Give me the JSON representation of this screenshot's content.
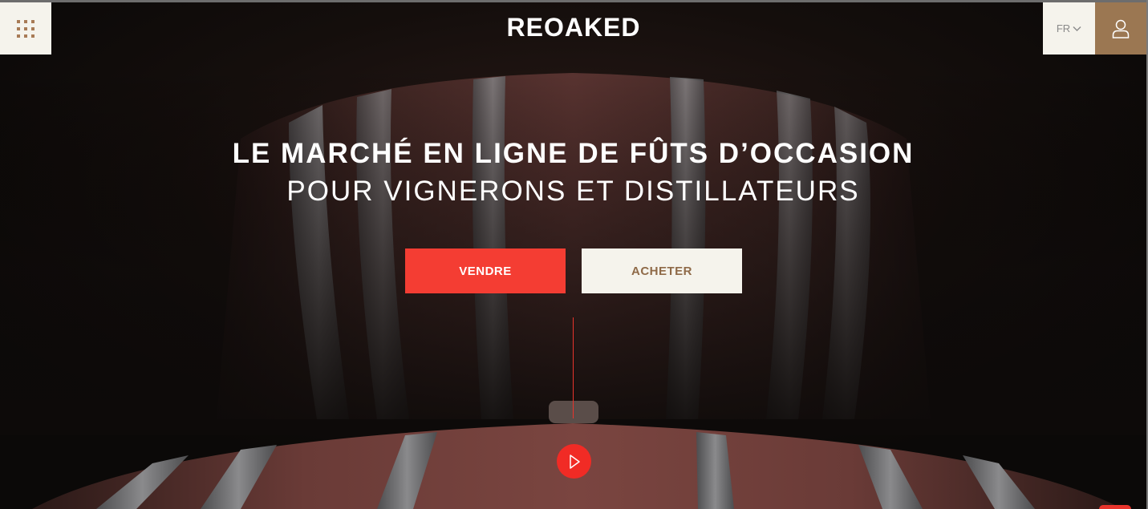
{
  "header": {
    "brand": "REOAKED",
    "menu_icon": "grid-menu-icon",
    "language": {
      "selected": "FR",
      "icon": "chevron-down-icon"
    },
    "account_icon": "user-icon"
  },
  "hero": {
    "headline": "LE MARCHÉ EN LIGNE DE FÛTS D’OCCASION",
    "subheadline": "POUR VIGNERONS ET DISTILLATEURS",
    "sell_label": "VENDRE",
    "buy_label": "ACHETER",
    "play_icon": "play-icon"
  },
  "colors": {
    "accent_red": "#f43d33",
    "cream": "#f5f3ec",
    "brand_brown": "#9b7752",
    "background": "#0d0a09"
  }
}
